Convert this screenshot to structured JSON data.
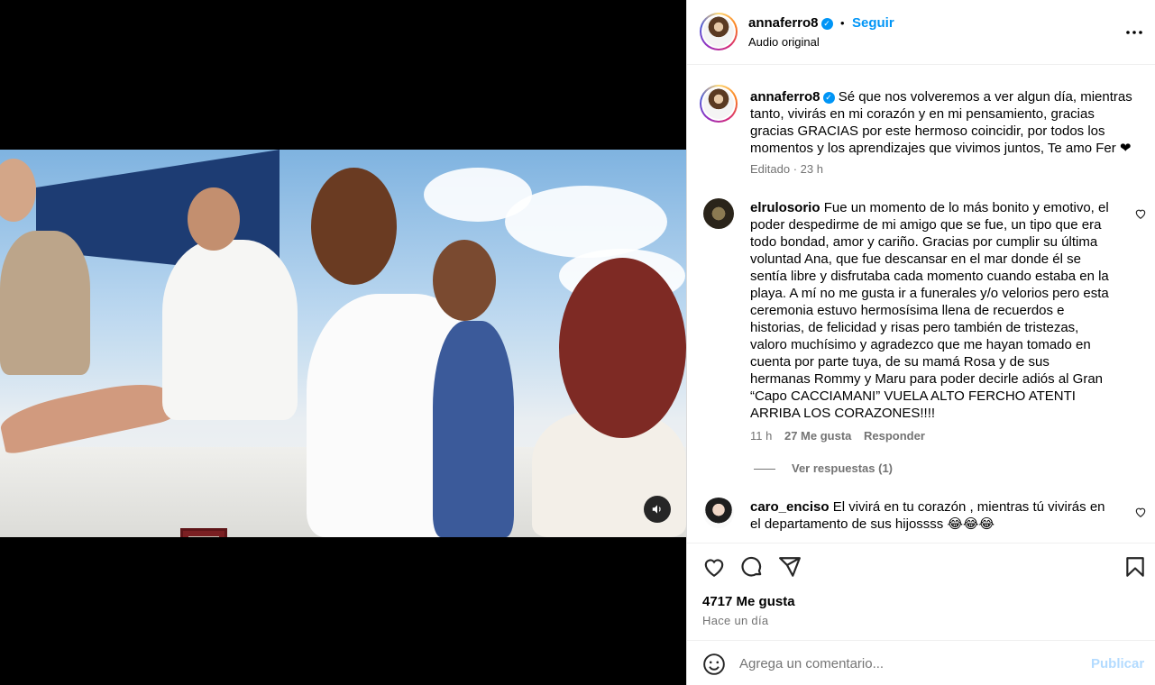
{
  "header": {
    "username": "annaferro8",
    "dot": "•",
    "follow_label": "Seguir",
    "audio": "Audio original",
    "more_icon": "more-horizontal-icon"
  },
  "caption": {
    "username": "annaferro8",
    "text": "Sé que nos volveremos a ver algun día, mientras tanto, vivirás en mi corazón y en mi pensamiento, gracias gracias GRACIAS por este hermoso coincidir, por todos los momentos y los aprendizajes que vivimos juntos, Te amo Fer ❤",
    "meta": "Editado · 23 h"
  },
  "comments": [
    {
      "username": "elrulosorio",
      "text": "Fue un momento de lo más bonito y emotivo, el poder despedirme de mi amigo que se fue, un tipo que era todo bondad, amor y cariño. Gracias por cumplir su última voluntad Ana, que fue descansar en el mar donde él se sentía libre y disfrutaba cada momento cuando estaba en la playa. A mí no me gusta ir a funerales y/o velorios pero esta ceremonia estuvo hermosísima llena de recuerdos e historias, de felicidad y risas pero también de tristezas, valoro muchísimo y agradezco que me hayan tomado en cuenta por parte tuya, de su mamá Rosa y de sus hermanas Rommy y Maru para poder decirle adiós al Gran “Capo CACCIAMANI” VUELA ALTO FERCHO ATENTI ARRIBA LOS CORAZONES!!!!",
      "time": "11 h",
      "likes": "27 Me gusta",
      "reply": "Responder",
      "view_replies": "Ver respuestas (1)"
    },
    {
      "username": "caro_enciso",
      "text": "El vivirá en tu corazón , mientras tú vivirás en el departamento de sus hijossss 😂😂😂"
    }
  ],
  "actions": {
    "likes": "4717 Me gusta",
    "date": "Hace un día"
  },
  "comment_box": {
    "placeholder": "Agrega un comentario...",
    "submit": "Publicar"
  },
  "colors": {
    "accent": "#0095f6",
    "verified": "#0095f6",
    "muted": "#737373",
    "publish_disabled": "#b3dbff"
  }
}
